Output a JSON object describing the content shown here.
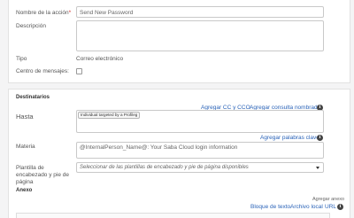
{
  "form": {
    "action_name_label": "Nombre de la acción",
    "required_mark": "*",
    "action_name_value": "Send New Password",
    "description_label": "Descripción",
    "description_value": "",
    "type_label": "Tipo",
    "type_value": "Correo electrónico",
    "message_center_label": "Centro de mensajes:",
    "message_center_checked": false
  },
  "recipients": {
    "section_title": "Destinatarios",
    "to_label": "Hasta",
    "add_cc_link": "Agregar CC y CCO",
    "add_named_query_link": "Agregar consulta nombrada",
    "to_chip": "Individual targeted by a Profileg",
    "subject_label": "Materia",
    "add_keywords_link": "Agregar palabras clave",
    "subject_value": "@InternalPerson_Name@: Your Saba Cloud login information",
    "template_label": "Plantilla de encabezado y pie de página",
    "template_placeholder": "Seleccionar de las plantillas de encabezado y pie de página disponibles"
  },
  "attachments": {
    "section_title": "Anexo",
    "add_attachment_label": "Agregar anexo",
    "text_block_link": "Bloque de texto",
    "local_file_link": "Archivo local",
    "url_link": "URL"
  },
  "icons": {
    "info": "info-icon",
    "dropdown": "chevron-down-icon"
  },
  "colors": {
    "link": "#2a63b8",
    "required": "#d0312d"
  }
}
